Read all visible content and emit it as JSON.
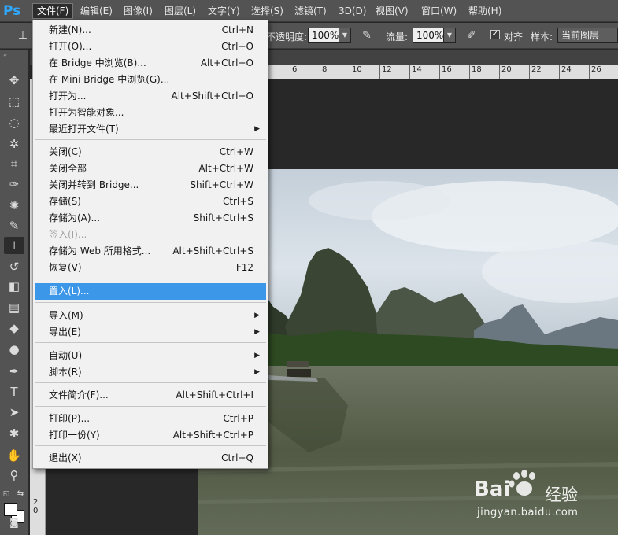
{
  "app": {
    "logo": "Ps",
    "brand_color": "#31a8ff"
  },
  "menubar": {
    "items": [
      {
        "label": "文件(F)"
      },
      {
        "label": "编辑(E)"
      },
      {
        "label": "图像(I)"
      },
      {
        "label": "图层(L)"
      },
      {
        "label": "文字(Y)"
      },
      {
        "label": "选择(S)"
      },
      {
        "label": "滤镜(T)"
      },
      {
        "label": "3D(D)"
      },
      {
        "label": "视图(V)"
      },
      {
        "label": "窗口(W)"
      },
      {
        "label": "帮助(H)"
      }
    ]
  },
  "options": {
    "opacity_label": "不透明度:",
    "opacity_value": "100%",
    "flow_label": "流量:",
    "flow_value": "100%",
    "align_label": "对齐",
    "align_checked": true,
    "sample_label": "样本:",
    "sample_value": "当前图层"
  },
  "ruler": {
    "h_ticks": [
      "6",
      "8",
      "10",
      "12",
      "14",
      "16",
      "18",
      "20",
      "22",
      "24",
      "26"
    ],
    "v_ticks": [
      "2",
      "0"
    ]
  },
  "file_menu": {
    "items": [
      {
        "label": "新建(N)...",
        "shortcut": "Ctrl+N"
      },
      {
        "label": "打开(O)...",
        "shortcut": "Ctrl+O"
      },
      {
        "label": "在 Bridge 中浏览(B)...",
        "shortcut": "Alt+Ctrl+O"
      },
      {
        "label": "在 Mini Bridge 中浏览(G)...",
        "shortcut": ""
      },
      {
        "label": "打开为...",
        "shortcut": "Alt+Shift+Ctrl+O"
      },
      {
        "label": "打开为智能对象...",
        "shortcut": ""
      },
      {
        "label": "最近打开文件(T)",
        "shortcut": "",
        "submenu": true
      },
      {
        "label": "关闭(C)",
        "shortcut": "Ctrl+W"
      },
      {
        "label": "关闭全部",
        "shortcut": "Alt+Ctrl+W"
      },
      {
        "label": "关闭并转到 Bridge...",
        "shortcut": "Shift+Ctrl+W"
      },
      {
        "label": "存储(S)",
        "shortcut": "Ctrl+S"
      },
      {
        "label": "存储为(A)...",
        "shortcut": "Shift+Ctrl+S"
      },
      {
        "label": "签入(I)...",
        "shortcut": "",
        "disabled": true
      },
      {
        "label": "存储为 Web 所用格式...",
        "shortcut": "Alt+Shift+Ctrl+S"
      },
      {
        "label": "恢复(V)",
        "shortcut": "F12"
      },
      {
        "label": "置入(L)...",
        "shortcut": "",
        "highlighted": true
      },
      {
        "label": "导入(M)",
        "shortcut": "",
        "submenu": true
      },
      {
        "label": "导出(E)",
        "shortcut": "",
        "submenu": true
      },
      {
        "label": "自动(U)",
        "shortcut": "",
        "submenu": true
      },
      {
        "label": "脚本(R)",
        "shortcut": "",
        "submenu": true
      },
      {
        "label": "文件简介(F)...",
        "shortcut": "Alt+Shift+Ctrl+I"
      },
      {
        "label": "打印(P)...",
        "shortcut": "Ctrl+P"
      },
      {
        "label": "打印一份(Y)",
        "shortcut": "Alt+Shift+Ctrl+P"
      },
      {
        "label": "退出(X)",
        "shortcut": "Ctrl+Q"
      }
    ],
    "highlight_color": "#3d97e8"
  },
  "watermark": {
    "brand": "Bai",
    "brand_suffix": "经验",
    "url": "jingyan.baidu.com"
  }
}
